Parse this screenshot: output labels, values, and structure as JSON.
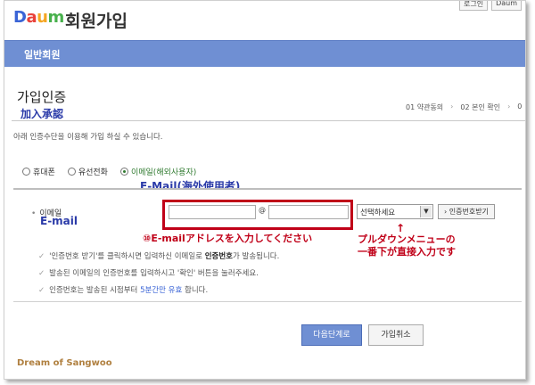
{
  "header": {
    "top_links": [
      "로그인",
      "Daum"
    ],
    "logo": "Daum",
    "title": "회원가입",
    "tab": "일반회원"
  },
  "section": {
    "title": "가입인증",
    "title_annotation": "加入承認",
    "steps": [
      "01 약관동의",
      "02 본인 확인",
      "0"
    ],
    "intro": "아래 인증수단을 이용해 가입 하실 수 있습니다."
  },
  "methods": {
    "options": [
      {
        "label": "휴대폰",
        "selected": false
      },
      {
        "label": "유선전화",
        "selected": false
      },
      {
        "label": "이메일(해외사용자)",
        "selected": true
      }
    ],
    "annotation": "E-Mail(海外使用者)"
  },
  "email_form": {
    "label": "이메일",
    "label_annotation": "E-mail",
    "local_value": "",
    "at": "@",
    "domain_value": "",
    "select_value": "선택하세요",
    "cert_button": "인증번호받기"
  },
  "annotations": {
    "step10": "⑩E-mailアドレスを入力してください",
    "arrow": "↑",
    "dropdown_line1": "プルダウンメニューの",
    "dropdown_line2": "一番下が直接入力です"
  },
  "notes": {
    "n1_a": "'인증번호 받기'를 클릭하시면 입력하신 이메일로 ",
    "n1_b": "인증번호",
    "n1_c": "가 발송됩니다.",
    "n2": "발송된 이메일의 인증번호를 입력하시고 '확인' 버튼을 눌러주세요.",
    "n3_a": "인증번호는 발송된 시점부터 ",
    "n3_b": "5분간만 유효",
    "n3_c": " 합니다."
  },
  "buttons": {
    "next": "다음단계로",
    "cancel": "가입취소"
  },
  "watermark": "Dream of Sangwoo",
  "colors": {
    "tab_bar": "#6f8fd3",
    "annotation_blue": "#2a3aa8",
    "annotation_red": "#c00018"
  }
}
